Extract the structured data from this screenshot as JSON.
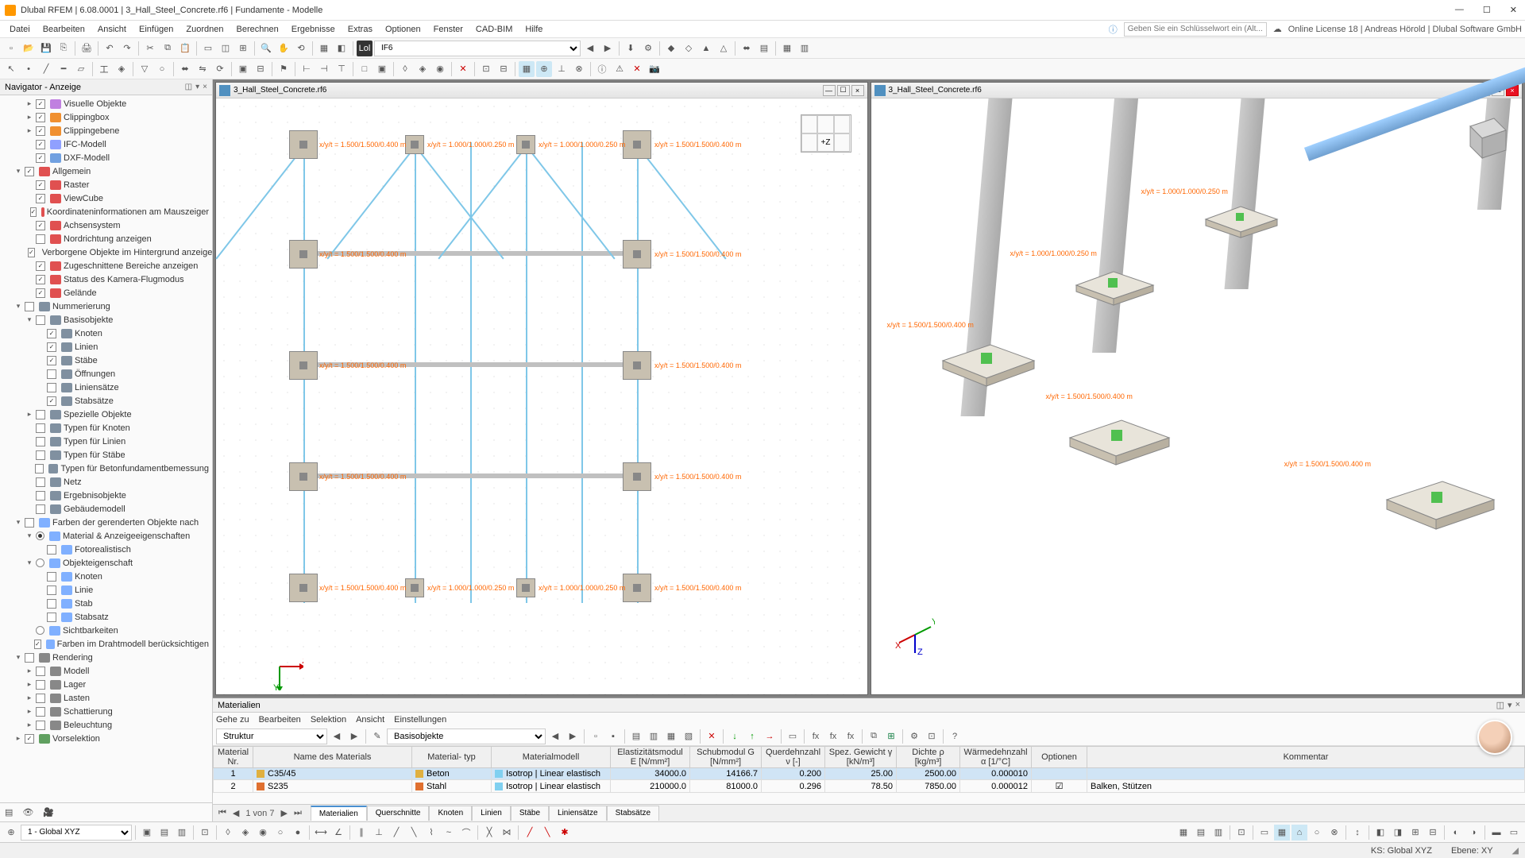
{
  "title": "Dlubal RFEM | 6.08.0001 | 3_Hall_Steel_Concrete.rf6 | Fundamente - Modelle",
  "menus": [
    "Datei",
    "Bearbeiten",
    "Ansicht",
    "Einfügen",
    "Zuordnen",
    "Berechnen",
    "Ergebnisse",
    "Extras",
    "Optionen",
    "Fenster",
    "CAD-BIM",
    "Hilfe"
  ],
  "menu_right": {
    "search_placeholder": "Geben Sie ein Schlüsselwort ein (Alt...",
    "license": "Online License 18 | Andreas Hörold | Dlubal Software GmbH"
  },
  "toolbar_ifc": "IF6",
  "toolbar_lol": "Lol",
  "navigator": {
    "title": "Navigator - Anzeige",
    "tree": [
      {
        "d": 2,
        "c": true,
        "t": "toggle",
        "open": false,
        "icon": "#c080e0",
        "label": "Visuelle Objekte"
      },
      {
        "d": 2,
        "c": true,
        "t": "toggle",
        "open": false,
        "icon": "#f09030",
        "label": "Clippingbox"
      },
      {
        "d": 2,
        "c": true,
        "t": "toggle",
        "open": false,
        "icon": "#f09030",
        "label": "Clippingebene"
      },
      {
        "d": 2,
        "c": true,
        "icon": "#90a0ff",
        "label": "IFC-Modell"
      },
      {
        "d": 2,
        "c": true,
        "icon": "#70a0e0",
        "label": "DXF-Modell"
      },
      {
        "d": 1,
        "c": true,
        "t": "toggle",
        "open": true,
        "icon": "#e05050",
        "label": "Allgemein"
      },
      {
        "d": 2,
        "c": true,
        "icon": "#e05050",
        "label": "Raster"
      },
      {
        "d": 2,
        "c": true,
        "icon": "#e05050",
        "label": "ViewCube"
      },
      {
        "d": 2,
        "c": true,
        "icon": "#e05050",
        "label": "Koordinateninformationen am Mauszeiger"
      },
      {
        "d": 2,
        "c": true,
        "icon": "#e05050",
        "label": "Achsensystem"
      },
      {
        "d": 2,
        "c": false,
        "icon": "#e05050",
        "label": "Nordrichtung anzeigen"
      },
      {
        "d": 2,
        "c": true,
        "icon": "#e05050",
        "label": "Verborgene Objekte im Hintergrund anzeigen"
      },
      {
        "d": 2,
        "c": true,
        "icon": "#e05050",
        "label": "Zugeschnittene Bereiche anzeigen"
      },
      {
        "d": 2,
        "c": true,
        "icon": "#e05050",
        "label": "Status des Kamera-Flugmodus"
      },
      {
        "d": 2,
        "c": true,
        "icon": "#e05050",
        "label": "Gelände"
      },
      {
        "d": 1,
        "c": false,
        "t": "toggle",
        "open": true,
        "icon": "#8090a0",
        "label": "Nummerierung"
      },
      {
        "d": 2,
        "c": false,
        "t": "toggle",
        "open": true,
        "icon": "#8090a0",
        "label": "Basisobjekte"
      },
      {
        "d": 3,
        "c": true,
        "icon": "#8090a0",
        "label": "Knoten"
      },
      {
        "d": 3,
        "c": true,
        "icon": "#8090a0",
        "label": "Linien"
      },
      {
        "d": 3,
        "c": true,
        "icon": "#8090a0",
        "label": "Stäbe"
      },
      {
        "d": 3,
        "c": false,
        "icon": "#8090a0",
        "label": "Öffnungen"
      },
      {
        "d": 3,
        "c": false,
        "icon": "#8090a0",
        "label": "Liniensätze"
      },
      {
        "d": 3,
        "c": true,
        "icon": "#8090a0",
        "label": "Stabsätze"
      },
      {
        "d": 2,
        "c": false,
        "t": "toggle",
        "open": false,
        "icon": "#8090a0",
        "label": "Spezielle Objekte"
      },
      {
        "d": 2,
        "c": false,
        "icon": "#8090a0",
        "label": "Typen für Knoten"
      },
      {
        "d": 2,
        "c": false,
        "icon": "#8090a0",
        "label": "Typen für Linien"
      },
      {
        "d": 2,
        "c": false,
        "icon": "#8090a0",
        "label": "Typen für Stäbe"
      },
      {
        "d": 2,
        "c": false,
        "icon": "#8090a0",
        "label": "Typen für Betonfundamentbemessung"
      },
      {
        "d": 2,
        "c": false,
        "icon": "#8090a0",
        "label": "Netz"
      },
      {
        "d": 2,
        "c": false,
        "icon": "#8090a0",
        "label": "Ergebnisobjekte"
      },
      {
        "d": 2,
        "c": false,
        "icon": "#8090a0",
        "label": "Gebäudemodell"
      },
      {
        "d": 1,
        "c": false,
        "t": "toggle",
        "open": true,
        "icon": "#80b0ff",
        "label": "Farben der gerenderten Objekte nach"
      },
      {
        "d": 2,
        "t": "radio",
        "c": true,
        "open": true,
        "icon": "#80b0ff",
        "label": "Material & Anzeigeeigenschaften"
      },
      {
        "d": 3,
        "c": false,
        "icon": "#80b0ff",
        "label": "Fotorealistisch"
      },
      {
        "d": 2,
        "t": "radio",
        "c": false,
        "open": true,
        "icon": "#80b0ff",
        "label": "Objekteigenschaft"
      },
      {
        "d": 3,
        "c": false,
        "icon": "#80b0ff",
        "label": "Knoten"
      },
      {
        "d": 3,
        "c": false,
        "icon": "#80b0ff",
        "label": "Linie"
      },
      {
        "d": 3,
        "c": false,
        "icon": "#80b0ff",
        "label": "Stab"
      },
      {
        "d": 3,
        "c": false,
        "icon": "#80b0ff",
        "label": "Stabsatz"
      },
      {
        "d": 2,
        "t": "radio",
        "c": false,
        "icon": "#80b0ff",
        "label": "Sichtbarkeiten"
      },
      {
        "d": 2,
        "c": true,
        "icon": "#80b0ff",
        "label": "Farben im Drahtmodell berücksichtigen"
      },
      {
        "d": 1,
        "c": false,
        "t": "toggle",
        "open": true,
        "icon": "#888",
        "label": "Rendering"
      },
      {
        "d": 2,
        "c": false,
        "t": "toggle",
        "open": false,
        "icon": "#888",
        "label": "Modell"
      },
      {
        "d": 2,
        "c": false,
        "t": "toggle",
        "open": false,
        "icon": "#888",
        "label": "Lager"
      },
      {
        "d": 2,
        "c": false,
        "t": "toggle",
        "open": false,
        "icon": "#888",
        "label": "Lasten"
      },
      {
        "d": 2,
        "c": false,
        "t": "toggle",
        "open": false,
        "icon": "#888",
        "label": "Schattierung"
      },
      {
        "d": 2,
        "c": false,
        "t": "toggle",
        "open": false,
        "icon": "#888",
        "label": "Beleuchtung"
      },
      {
        "d": 1,
        "c": true,
        "t": "toggle",
        "open": false,
        "icon": "#60a060",
        "label": "Vorselektion"
      }
    ]
  },
  "viewport_title": "3_Hall_Steel_Concrete.rf6",
  "viewcube_label": "+Z",
  "fnd_labels_2d": {
    "large": "x/y/t = 1.500/1.500/0.400 m",
    "small": "x/y/t = 1.000/1.000/0.250 m"
  },
  "fnd_labels_3d": {
    "small": "x/y/t = 1.000/1.000/0.250 m",
    "large": "x/y/t = 1.500/1.500/0.400 m"
  },
  "bottom": {
    "title": "Materialien",
    "menu": [
      "Gehe zu",
      "Bearbeiten",
      "Selektion",
      "Ansicht",
      "Einstellungen"
    ],
    "combo1": "Struktur",
    "combo2": "Basisobjekte",
    "headers": {
      "nr": "Material\nNr.",
      "name": "Name des Materials",
      "type": "Material-\ntyp",
      "model": "Materialmodell",
      "e": "Elastizitätsmodul\nE [N/mm²]",
      "g": "Schubmodul\nG [N/mm²]",
      "v": "Querdehnzahl\nν [-]",
      "gamma": "Spez. Gewicht\nγ [kN/m³]",
      "rho": "Dichte\nρ [kg/m³]",
      "alpha": "Wärmedehnzahl\nα [1/°C]",
      "opt": "Optionen",
      "comment": "Kommentar"
    },
    "rows": [
      {
        "nr": "1",
        "name": "C35/45",
        "sw": "#e0b040",
        "type": "Beton",
        "tsw": "#80d0f0",
        "model": "Isotrop | Linear elastisch",
        "e": "34000.0",
        "g": "14166.7",
        "v": "0.200",
        "gamma": "25.00",
        "rho": "2500.00",
        "alpha": "0.000010",
        "opt": "",
        "comment": "",
        "sel": true
      },
      {
        "nr": "2",
        "name": "S235",
        "sw": "#e07030",
        "type": "Stahl",
        "tsw": "#80d0f0",
        "model": "Isotrop | Linear elastisch",
        "e": "210000.0",
        "g": "81000.0",
        "v": "0.296",
        "gamma": "78.50",
        "rho": "7850.00",
        "alpha": "0.000012",
        "opt": "☑",
        "comment": "Balken, Stützen"
      }
    ],
    "pager": "1 von 7",
    "tabs": [
      "Materialien",
      "Querschnitte",
      "Knoten",
      "Linien",
      "Stäbe",
      "Liniensätze",
      "Stabsätze"
    ]
  },
  "bottom_toolbar_combo": "1 - Global XYZ",
  "status": {
    "ks": "KS: Global XYZ",
    "ebene": "Ebene: XY"
  }
}
